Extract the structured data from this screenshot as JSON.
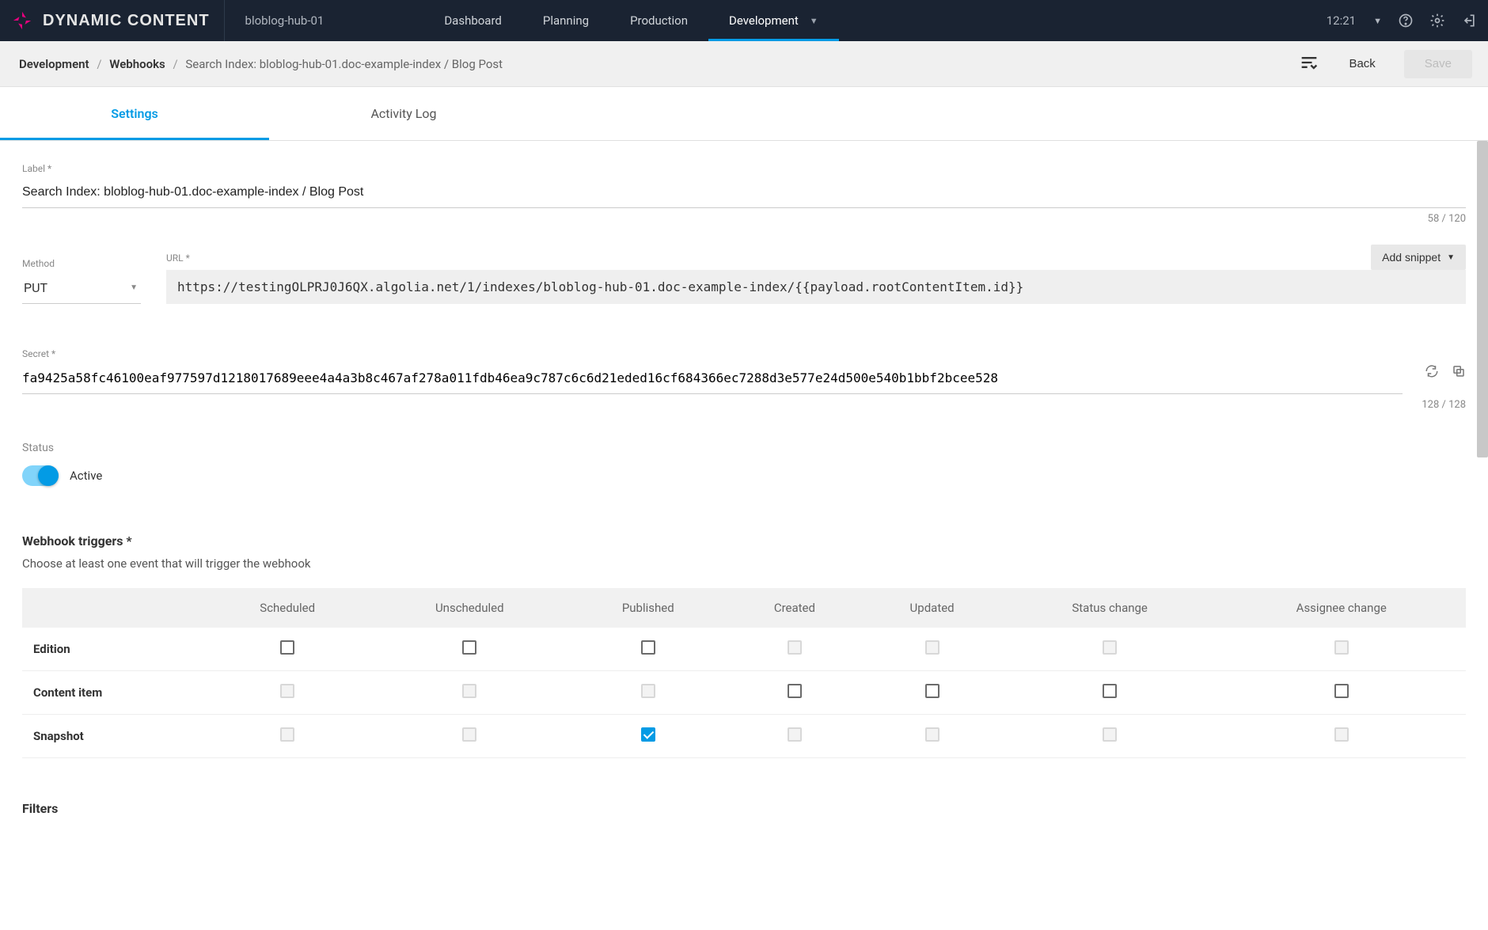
{
  "header": {
    "app_name": "DYNAMIC CONTENT",
    "hub_name": "bloblog-hub-01",
    "tabs": [
      "Dashboard",
      "Planning",
      "Production",
      "Development"
    ],
    "active_tab": 3,
    "time": "12:21"
  },
  "breadcrumb": {
    "items": [
      "Development",
      "Webhooks"
    ],
    "current": "Search Index: bloblog-hub-01.doc-example-index / Blog Post"
  },
  "actions": {
    "back": "Back",
    "save": "Save"
  },
  "page_tabs": {
    "items": [
      "Settings",
      "Activity Log"
    ],
    "active": 0
  },
  "form": {
    "label_field": {
      "label": "Label *",
      "value": "Search Index: bloblog-hub-01.doc-example-index / Blog Post",
      "counter": "58 / 120"
    },
    "method_field": {
      "label": "Method",
      "value": "PUT"
    },
    "url_field": {
      "label": "URL *",
      "value": "https://testingOLPRJ0J6QX.algolia.net/1/indexes/bloblog-hub-01.doc-example-index/{{payload.rootContentItem.id}}"
    },
    "add_snippet": "Add snippet",
    "secret_field": {
      "label": "Secret *",
      "value": "fa9425a58fc46100eaf977597d1218017689eee4a4a3b8c467af278a011fdb46ea9c787c6c6d21eded16cf684366ec7288d3e577e24d500e540b1bbf2bcee528",
      "counter": "128 / 128"
    },
    "status": {
      "label": "Status",
      "value": "Active",
      "on": true
    }
  },
  "triggers": {
    "title": "Webhook triggers *",
    "subtitle": "Choose at least one event that will trigger the webhook",
    "columns": [
      "Scheduled",
      "Unscheduled",
      "Published",
      "Created",
      "Updated",
      "Status change",
      "Assignee change"
    ],
    "rows": [
      {
        "name": "Edition",
        "cells": [
          "unchecked",
          "unchecked",
          "unchecked",
          "disabled",
          "disabled",
          "disabled",
          "disabled"
        ]
      },
      {
        "name": "Content item",
        "cells": [
          "disabled",
          "disabled",
          "disabled",
          "unchecked",
          "unchecked",
          "unchecked",
          "unchecked"
        ]
      },
      {
        "name": "Snapshot",
        "cells": [
          "disabled",
          "disabled",
          "checked",
          "disabled",
          "disabled",
          "disabled",
          "disabled"
        ]
      }
    ]
  },
  "filters": {
    "title": "Filters"
  }
}
